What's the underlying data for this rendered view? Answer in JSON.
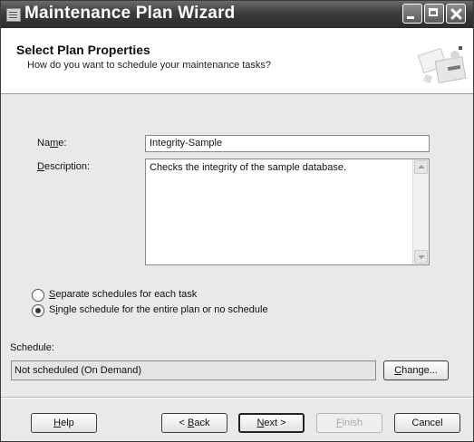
{
  "window": {
    "title": "Maintenance Plan Wizard"
  },
  "header": {
    "title": "Select Plan Properties",
    "subtitle": "How do you want to schedule your maintenance tasks?",
    "graphic_icon": "wizard-graphic-icon"
  },
  "form": {
    "name_label_pre": "Na",
    "name_label_key": "m",
    "name_label_post": "e:",
    "name_value": "Integrity-Sample",
    "description_label_key": "D",
    "description_label_post": "escription:",
    "description_value": "Checks the integrity of the sample database."
  },
  "schedule_options": [
    {
      "pre": "",
      "key": "S",
      "post": "eparate schedules for each task",
      "selected": false
    },
    {
      "pre": "S",
      "key": "i",
      "post": "ngle schedule for the entire plan or no schedule",
      "selected": true
    }
  ],
  "schedule": {
    "label": "Schedule:",
    "value": "Not scheduled (On Demand)",
    "change_key": "C",
    "change_post": "hange..."
  },
  "buttons": {
    "help_key": "H",
    "help_post": "elp",
    "back_pre": "< ",
    "back_key": "B",
    "back_post": "ack",
    "next_pre": "",
    "next_key": "N",
    "next_post": "ext >",
    "finish_key": "F",
    "finish_post": "inish",
    "cancel": "Cancel"
  }
}
